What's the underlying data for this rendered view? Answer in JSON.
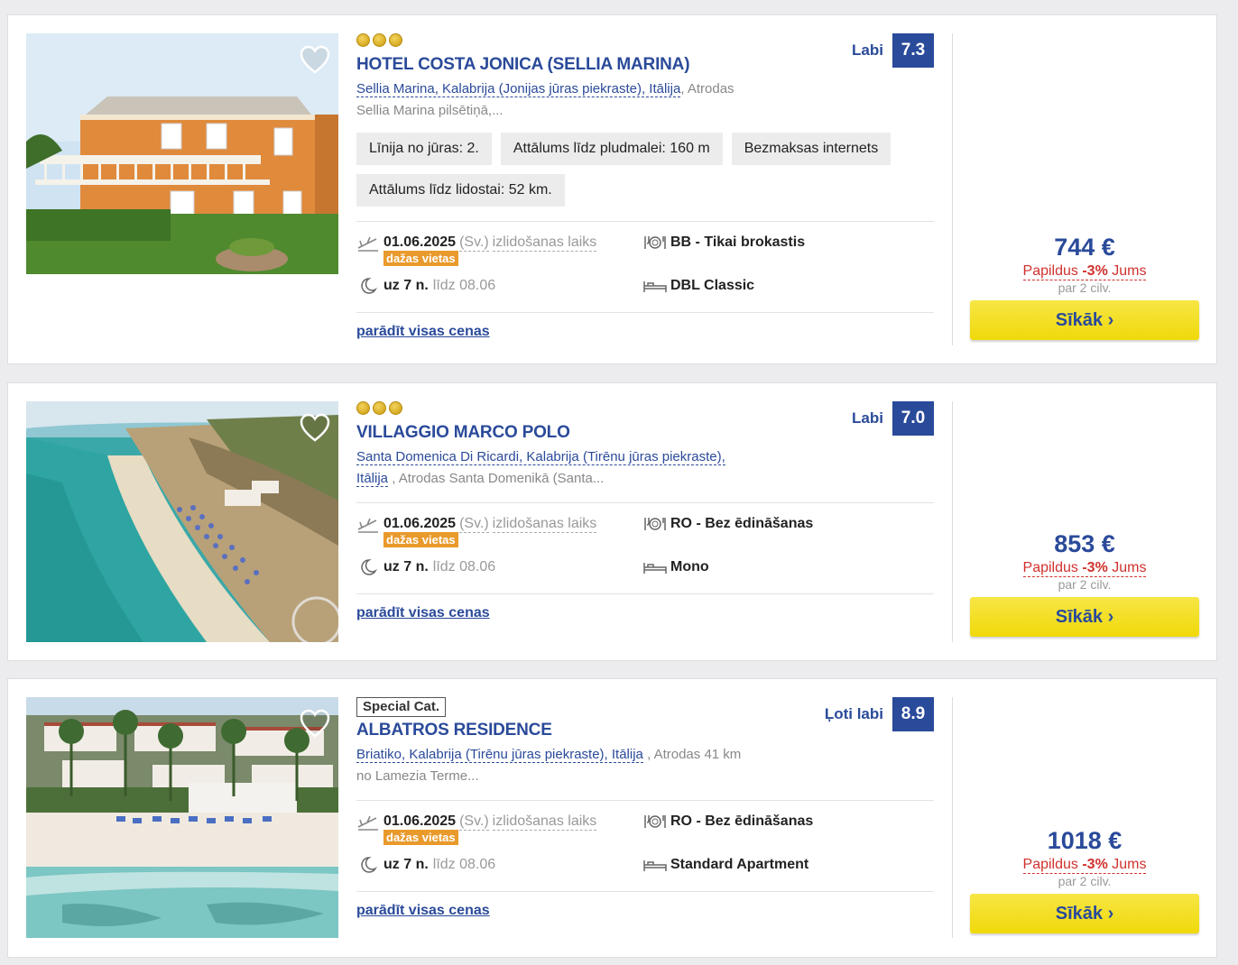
{
  "hotels": [
    {
      "category": "3 stars",
      "name": "HOTEL COSTA JONICA (SELLIA MARINA)",
      "location_link": "Sellia Marina, Kalabrija (Jonijas jūras piekraste), Itālija",
      "location_rest": ", Atrodas",
      "location_line2": "Sellia Marina pilsētiņā,...",
      "rating_label": "Labi",
      "rating_score": "7.3",
      "tags": [
        "Līnija no jūras: 2.",
        "Attālums līdz pludmalei: 160 m",
        "Bezmaksas internets",
        "Attālums līdz lidostai: 52 km."
      ],
      "date": "01.06.2025",
      "day": "(Sv.)",
      "departure_label": "izlidošanas laiks",
      "availability": "dažas vietas",
      "nights": "uz 7 n.",
      "until": "līdz 08.06",
      "board": "BB - Tikai brokastis",
      "room": "DBL Classic",
      "all_prices": "parādīt visas cenas",
      "price": "744 €",
      "extra_pre": "Papildus ",
      "extra_pct": "-3%",
      "extra_post": " Jums",
      "per": "par 2 cilv.",
      "button": "Sīkāk ›"
    },
    {
      "category": "3 stars",
      "name": "VILLAGGIO MARCO POLO",
      "location_link": "Santa Domenica Di Ricardi, Kalabrija (Tirēnu jūras piekraste),",
      "location_link2": "Itālija",
      "location_rest": " , Atrodas Santa Domenikā (Santa...",
      "rating_label": "Labi",
      "rating_score": "7.0",
      "date": "01.06.2025",
      "day": "(Sv.)",
      "departure_label": "izlidošanas laiks",
      "availability": "dažas vietas",
      "nights": "uz 7 n.",
      "until": "līdz 08.06",
      "board": "RO - Bez ēdināšanas",
      "room": "Mono",
      "all_prices": "parādīt visas cenas",
      "price": "853 €",
      "extra_pre": "Papildus ",
      "extra_pct": "-3%",
      "extra_post": " Jums",
      "per": "par 2 cilv.",
      "button": "Sīkāk ›"
    },
    {
      "category": "Special Cat.",
      "name": "ALBATROS RESIDENCE",
      "location_link": "Briatiko, Kalabrija (Tirēnu jūras piekraste), Itālija",
      "location_rest": " , Atrodas 41 km",
      "location_line2": "no Lamezia Terme...",
      "rating_label": "Ļoti labi",
      "rating_score": "8.9",
      "date": "01.06.2025",
      "day": "(Sv.)",
      "departure_label": "izlidošanas laiks",
      "availability": "dažas vietas",
      "nights": "uz 7 n.",
      "until": "līdz 08.06",
      "board": "RO - Bez ēdināšanas",
      "room": "Standard Apartment",
      "all_prices": "parādīt visas cenas",
      "price": "1018 €",
      "extra_pre": "Papildus ",
      "extra_pct": "-3%",
      "extra_post": " Jums",
      "per": "par 2 cilv.",
      "button": "Sīkāk ›"
    }
  ],
  "colors": {
    "brand_blue": "#2a4a9a",
    "button_yellow": "#f0d90a",
    "badge_orange": "#e99a2c",
    "discount_red": "#d0312d"
  }
}
